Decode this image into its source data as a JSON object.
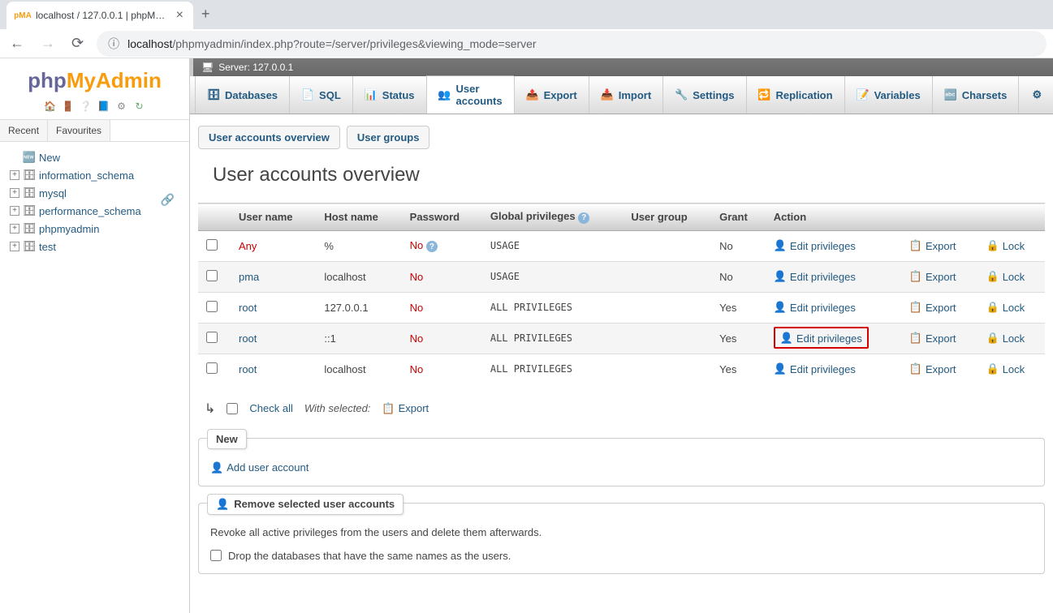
{
  "browser": {
    "tab_title": "localhost / 127.0.0.1 | phpMyAdmin",
    "url_host": "localhost",
    "url_path": "/phpmyadmin/index.php?route=/server/privileges&viewing_mode=server"
  },
  "sidebar": {
    "tabs": {
      "recent": "Recent",
      "favourites": "Favourites"
    },
    "new_label": "New",
    "databases": [
      "information_schema",
      "mysql",
      "performance_schema",
      "phpmyadmin",
      "test"
    ]
  },
  "server_bar": {
    "label": "Server: 127.0.0.1"
  },
  "top_tabs": [
    "Databases",
    "SQL",
    "Status",
    "User accounts",
    "Export",
    "Import",
    "Settings",
    "Replication",
    "Variables",
    "Charsets"
  ],
  "sub_tabs": {
    "overview": "User accounts overview",
    "groups": "User groups"
  },
  "page_title": "User accounts overview",
  "table": {
    "headers": {
      "username": "User name",
      "hostname": "Host name",
      "password": "Password",
      "global": "Global privileges",
      "usergroup": "User group",
      "grant": "Grant",
      "action": "Action"
    },
    "action_labels": {
      "edit": "Edit privileges",
      "export": "Export",
      "lock": "Lock"
    },
    "rows": [
      {
        "user": "Any",
        "is_any": true,
        "host": "%",
        "password": "No",
        "pw_help": true,
        "privileges": "USAGE",
        "usergroup": "",
        "grant": "No",
        "highlight": false
      },
      {
        "user": "pma",
        "is_any": false,
        "host": "localhost",
        "password": "No",
        "pw_help": false,
        "privileges": "USAGE",
        "usergroup": "",
        "grant": "No",
        "highlight": false
      },
      {
        "user": "root",
        "is_any": false,
        "host": "127.0.0.1",
        "password": "No",
        "pw_help": false,
        "privileges": "ALL PRIVILEGES",
        "usergroup": "",
        "grant": "Yes",
        "highlight": false
      },
      {
        "user": "root",
        "is_any": false,
        "host": "::1",
        "password": "No",
        "pw_help": false,
        "privileges": "ALL PRIVILEGES",
        "usergroup": "",
        "grant": "Yes",
        "highlight": true
      },
      {
        "user": "root",
        "is_any": false,
        "host": "localhost",
        "password": "No",
        "pw_help": false,
        "privileges": "ALL PRIVILEGES",
        "usergroup": "",
        "grant": "Yes",
        "highlight": false
      }
    ]
  },
  "check_all": {
    "label": "Check all",
    "with_selected": "With selected:",
    "export": "Export"
  },
  "new_panel": {
    "title": "New",
    "add_user": "Add user account"
  },
  "remove_panel": {
    "title": "Remove selected user accounts",
    "text": "Revoke all active privileges from the users and delete them afterwards.",
    "drop_label": "Drop the databases that have the same names as the users."
  }
}
